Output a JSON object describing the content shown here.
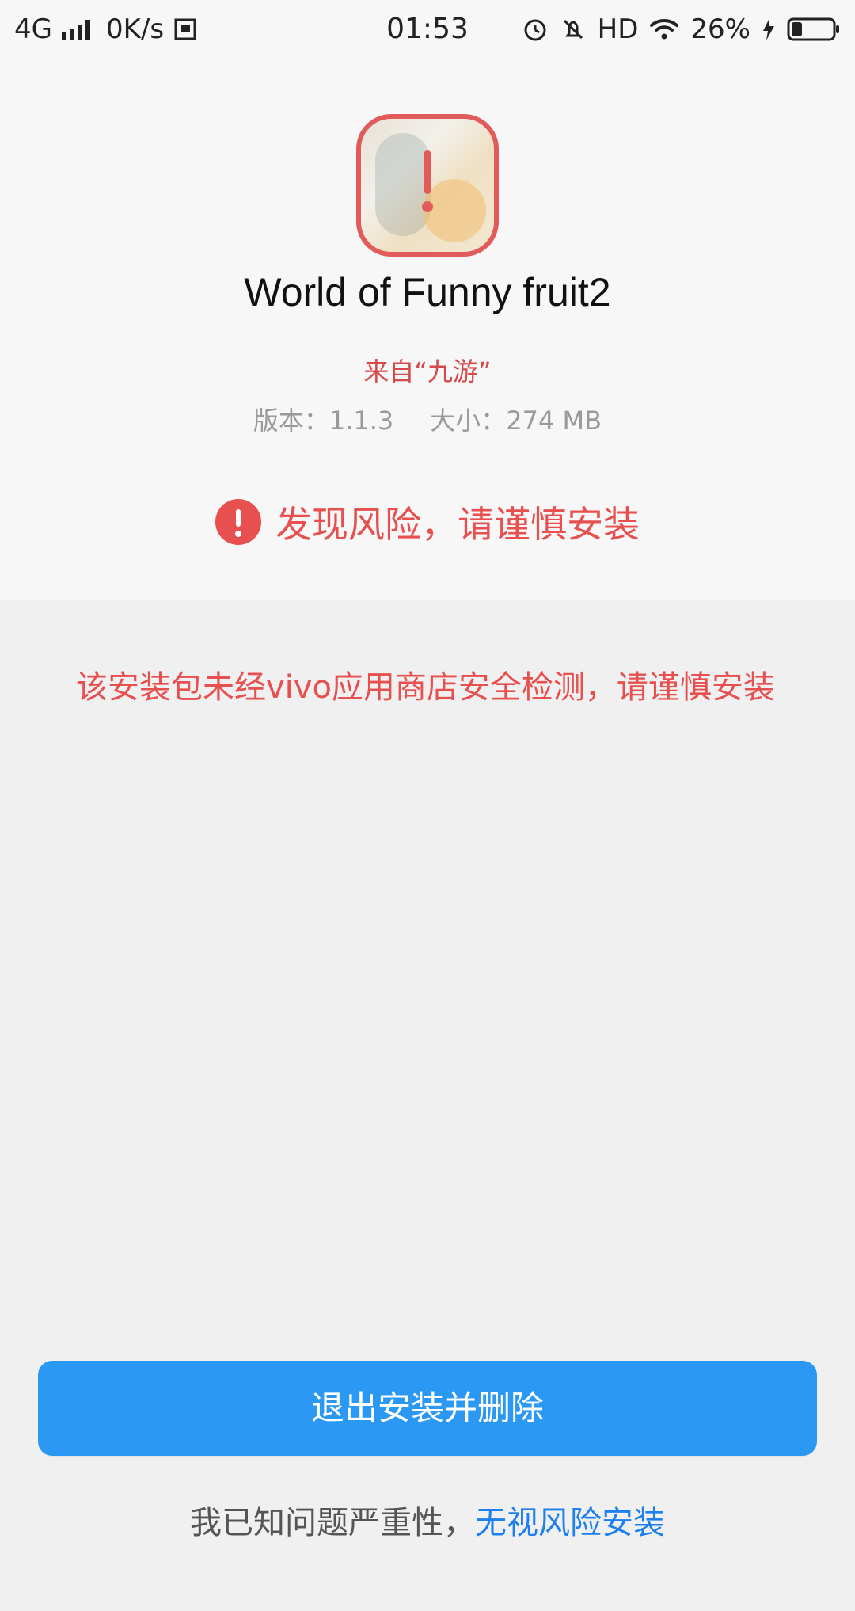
{
  "status_bar": {
    "network": "4G",
    "speed": "0K/s",
    "time": "01:53",
    "hd": "HD",
    "battery_percent": "26%"
  },
  "app": {
    "name": "World of Funny fruit2",
    "source": "来自“九游”",
    "version_label": "版本：1.1.3",
    "size_label": "大小：274 MB"
  },
  "risk": {
    "title": "发现风险，请谨慎安装",
    "description": "该安装包未经vivo应用商店安全检测，请谨慎安装"
  },
  "actions": {
    "primary_button": "退出安装并删除",
    "footer_prefix": "我已知问题严重性，",
    "footer_link": "无视风险安装"
  },
  "colors": {
    "danger": "#e84f4f",
    "primary": "#2b99f3",
    "link": "#1d7ff0"
  },
  "icons": {
    "signal": "signal-icon",
    "usb": "usb-icon",
    "alarm": "alarm-icon",
    "mute": "bell-off-icon",
    "wifi": "wifi-icon",
    "charging": "charging-bolt-icon",
    "battery": "battery-icon",
    "warning": "warning-icon"
  }
}
